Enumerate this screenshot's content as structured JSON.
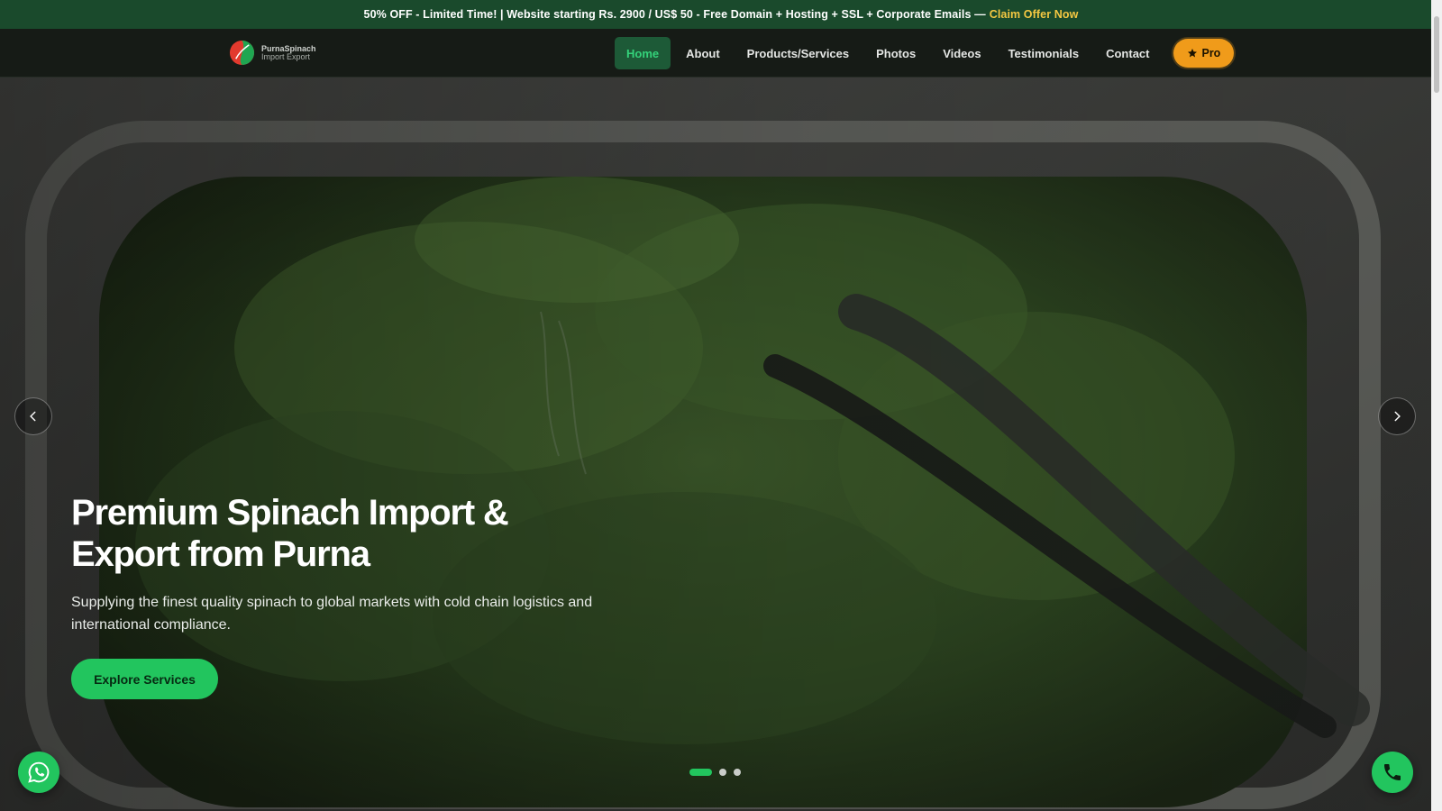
{
  "promo": {
    "text": "50% OFF - Limited Time! | Website starting Rs. 2900 / US$ 50 - Free Domain + Hosting + SSL + Corporate Emails —",
    "link_label": "Claim Offer Now"
  },
  "brand": {
    "name_line1": "PurnaSpinach",
    "name_line2": "Import Export",
    "logo_icon": "leaf-logo-icon"
  },
  "nav": {
    "items": [
      {
        "label": "Home",
        "active": true
      },
      {
        "label": "About"
      },
      {
        "label": "Products/Services"
      },
      {
        "label": "Photos"
      },
      {
        "label": "Videos"
      },
      {
        "label": "Testimonials"
      },
      {
        "label": "Contact"
      }
    ],
    "pro_label": "Pro",
    "pro_icon": "star-icon"
  },
  "hero": {
    "title_line1": "Premium Spinach Import &",
    "title_line2": "Export from Purna",
    "subtitle": "Supplying the finest quality spinach to global markets with cold chain logistics and international compliance.",
    "cta_label": "Explore Services",
    "slides": 3,
    "active_slide": 1
  },
  "colors": {
    "promo_bg": "#1a4a2c",
    "accent_green": "#22c55e",
    "pro_orange": "#f09b1a",
    "offer_yellow": "#f5c842"
  },
  "icons": {
    "prev": "chevron-left-icon",
    "next": "chevron-right-icon",
    "whatsapp": "whatsapp-icon",
    "phone": "phone-icon"
  }
}
